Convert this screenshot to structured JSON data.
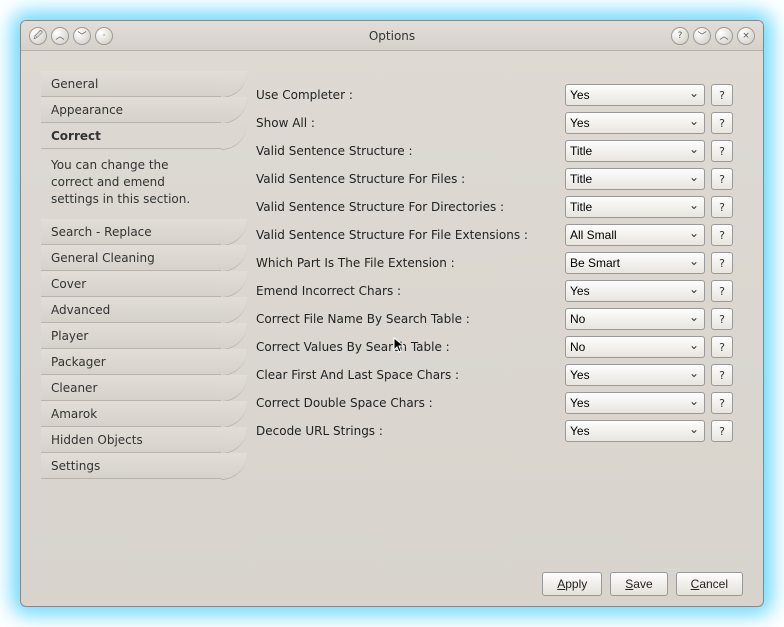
{
  "title": "Options",
  "sidebar": {
    "top": [
      "General",
      "Appearance",
      "Correct"
    ],
    "active": "Correct",
    "desc": "You can change the correct and emend settings in this section.",
    "bottom": [
      "Search - Replace",
      "General Cleaning",
      "Cover",
      "Advanced",
      "Player",
      "Packager",
      "Cleaner",
      "Amarok",
      "Hidden Objects",
      "Settings"
    ]
  },
  "rows": [
    {
      "label": "Use Completer :",
      "value": "Yes"
    },
    {
      "label": "Show All :",
      "value": "Yes"
    },
    {
      "label": "Valid Sentence Structure :",
      "value": "Title"
    },
    {
      "label": "Valid Sentence Structure For Files :",
      "value": "Title"
    },
    {
      "label": "Valid Sentence Structure For Directories :",
      "value": "Title"
    },
    {
      "label": "Valid Sentence Structure For File Extensions :",
      "value": "All Small"
    },
    {
      "label": "Which Part Is The File Extension :",
      "value": "Be Smart"
    },
    {
      "label": "Emend Incorrect Chars :",
      "value": "Yes"
    },
    {
      "label": "Correct File Name By Search Table :",
      "value": "No"
    },
    {
      "label": "Correct Values By Search Table :",
      "value": "No"
    },
    {
      "label": "Clear First And Last Space Chars :",
      "value": "Yes"
    },
    {
      "label": "Correct Double Space Chars :",
      "value": "Yes"
    },
    {
      "label": "Decode URL Strings :",
      "value": "Yes"
    }
  ],
  "buttons": {
    "apply": "Apply",
    "save": "Save",
    "cancel": "Cancel"
  },
  "help_char": "?"
}
